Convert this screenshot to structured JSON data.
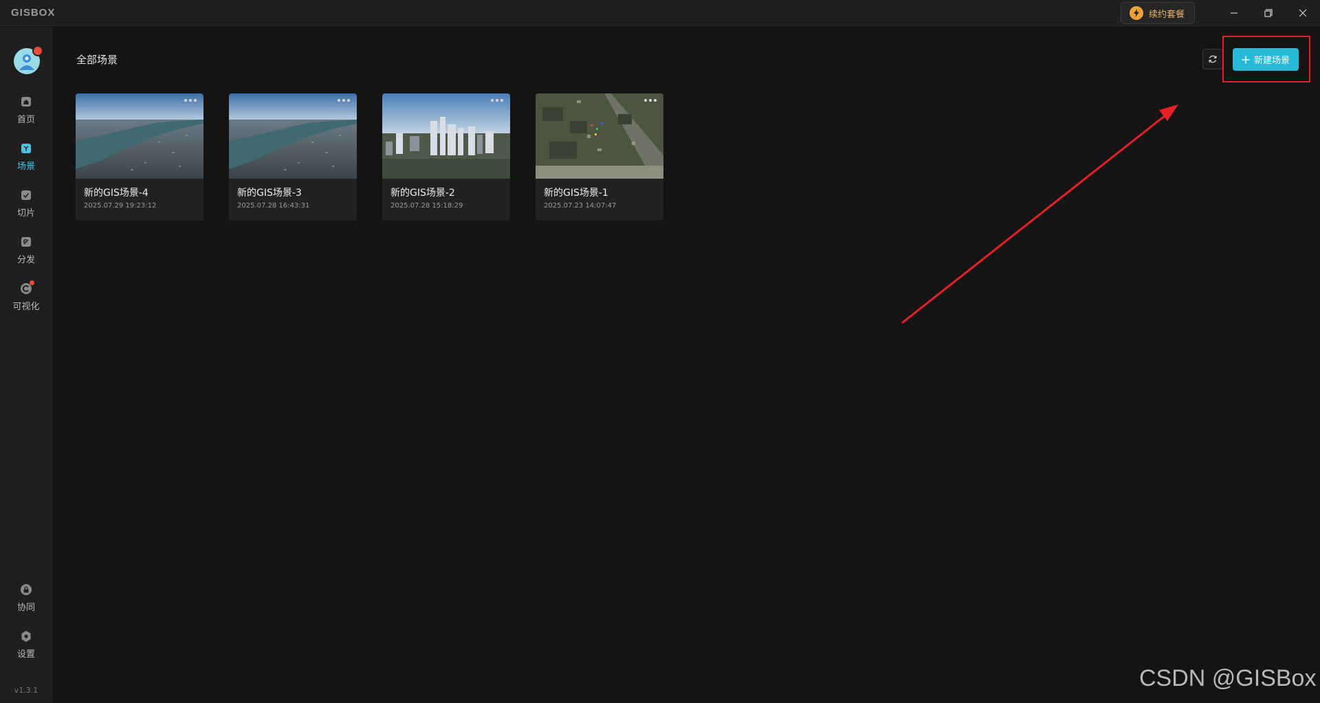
{
  "app": {
    "logo": "GISBOX"
  },
  "titlebar": {
    "renew_label": "续约套餐"
  },
  "sidebar": {
    "items": [
      {
        "label": "首页",
        "icon": "home-icon"
      },
      {
        "label": "场景",
        "icon": "scene-cube-icon",
        "active": true
      },
      {
        "label": "切片",
        "icon": "tile-icon"
      },
      {
        "label": "分发",
        "icon": "publish-icon"
      },
      {
        "label": "可视化",
        "icon": "visual-icon"
      },
      {
        "label": "协同",
        "icon": "lock-icon"
      },
      {
        "label": "设置",
        "icon": "gear-icon"
      }
    ],
    "version": "v1.3.1"
  },
  "main": {
    "title": "全部场景",
    "new_scene_label": "新建场景",
    "scenes": [
      {
        "name": "新的GIS场景-4",
        "date": "2025.07.29 19:23:12"
      },
      {
        "name": "新的GIS场景-3",
        "date": "2025.07.28 16:43:31"
      },
      {
        "name": "新的GIS场景-2",
        "date": "2025.07.28 15:18:29"
      },
      {
        "name": "新的GIS场景-1",
        "date": "2025.07.23 14:07:47"
      }
    ]
  },
  "watermark": "CSDN @GISBox",
  "colors": {
    "accent": "#26b9d8",
    "annotation": "#e8202a",
    "background": "#141414"
  }
}
